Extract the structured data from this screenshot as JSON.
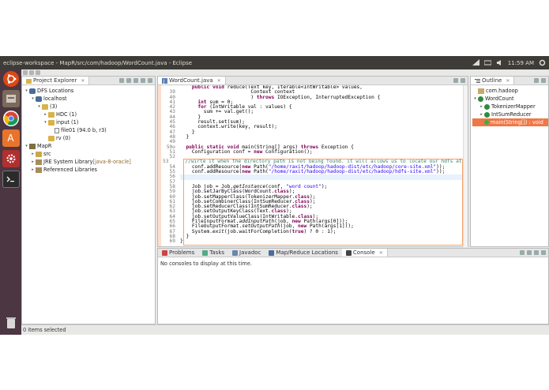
{
  "topbar": {
    "title": "eclipse-workspace - MapR/src/com/hadoop/WordCount.java - Eclipse",
    "time": "11:59 AM"
  },
  "launcher": {
    "icons": [
      "ubuntu-dash-icon",
      "files-icon",
      "chrome-icon",
      "amplifier-icon",
      "system-settings-icon",
      "eclipse-icon",
      "terminal-icon",
      "trash-icon"
    ]
  },
  "project_explorer": {
    "tab_label": "Project Explorer",
    "tree": [
      {
        "label": "DFS Locations",
        "indent": 0,
        "twisty": "▾",
        "icon": "elephant"
      },
      {
        "label": "localhost",
        "indent": 1,
        "twisty": "▾",
        "icon": "elephant"
      },
      {
        "label": "(3)",
        "indent": 2,
        "twisty": "▾",
        "icon": "folder"
      },
      {
        "label": "HDC (1)",
        "indent": 3,
        "twisty": "▸",
        "icon": "folder"
      },
      {
        "label": "input (1)",
        "indent": 3,
        "twisty": "▾",
        "icon": "folder"
      },
      {
        "label": "file01 (94.0 b, r3)",
        "indent": 4,
        "twisty": "",
        "icon": "file"
      },
      {
        "label": "rv (0)",
        "indent": 3,
        "twisty": "",
        "icon": "folder"
      },
      {
        "label": "MapR",
        "indent": 0,
        "twisty": "▾",
        "icon": "project"
      },
      {
        "label": "src",
        "indent": 1,
        "twisty": "▸",
        "icon": "src"
      },
      {
        "label": "JRE System Library",
        "tag": "[java-8-oracle]",
        "indent": 1,
        "twisty": "▸",
        "icon": "lib"
      },
      {
        "label": "Referenced Libraries",
        "indent": 1,
        "twisty": "▸",
        "icon": "lib"
      }
    ]
  },
  "editor": {
    "tab_label": "WordCount.java",
    "lines": [
      {
        "n": "",
        "t": "    public void reduce(Text key, Iterable<IntWritable> values,"
      },
      {
        "n": "39",
        "t": "                        Context context"
      },
      {
        "n": "40",
        "t": "                        ) throws IOException, InterruptedException {"
      },
      {
        "n": "41",
        "t": "      int sum = 0;"
      },
      {
        "n": "42",
        "t": "      for (IntWritable val : values) {"
      },
      {
        "n": "43",
        "t": "        sum += val.get();"
      },
      {
        "n": "44",
        "t": "      }"
      },
      {
        "n": "45",
        "t": "      result.set(sum);"
      },
      {
        "n": "46",
        "t": "      context.write(key, result);"
      },
      {
        "n": "47",
        "t": "    }"
      },
      {
        "n": "48",
        "t": "  }"
      },
      {
        "n": "49",
        "t": ""
      },
      {
        "n": "50⊖",
        "t": "  public static void main(String[] args) throws Exception {"
      },
      {
        "n": "51",
        "t": "    Configuration conf = new Configuration();"
      },
      {
        "n": "52",
        "t": ""
      },
      {
        "n": "53",
        "t": "    //wirte it when the directory path is not being found. it will allows us to locate our hdfs at /"
      },
      {
        "n": "54",
        "t": "    conf.addResource(new Path(\"/home/raxit/hadoop/hadoop-dist/etc/hadoop/core-site.xml\"));"
      },
      {
        "n": "55",
        "t": "    conf.addResource(new Path(\"/home/raxit/hadoop/hadoop-dist/etc/hadoop/hdfs-site.xml\"));"
      },
      {
        "n": "56",
        "t": ""
      },
      {
        "n": "57",
        "t": ""
      },
      {
        "n": "58",
        "t": "    Job job = Job.getInstance(conf, \"word count\");"
      },
      {
        "n": "59",
        "t": "    job.setJarByClass(WordCount.class);"
      },
      {
        "n": "60",
        "t": "    job.setMapperClass(TokenizerMapper.class);"
      },
      {
        "n": "61",
        "t": "    job.setCombinerClass(IntSumReducer.class);"
      },
      {
        "n": "62",
        "t": "    job.setReducerClass(IntSumReducer.class);"
      },
      {
        "n": "63",
        "t": "    job.setOutputKeyClass(Text.class);"
      },
      {
        "n": "64",
        "t": "    job.setOutputValueClass(IntWritable.class);"
      },
      {
        "n": "65",
        "t": "    FileInputFormat.addInputPath(job, new Path(args[0]));"
      },
      {
        "n": "66",
        "t": "    FileOutputFormat.setOutputPath(job, new Path(args[1]));"
      },
      {
        "n": "67",
        "t": "    System.exit(job.waitForCompletion(true) ? 0 : 1);"
      },
      {
        "n": "68",
        "t": "  }"
      },
      {
        "n": "69",
        "t": "}"
      }
    ],
    "current_line": "56"
  },
  "outline": {
    "tab_label": "Outline",
    "tree": [
      {
        "label": "com.hadoop",
        "indent": 0,
        "twisty": "",
        "icon": "pkg"
      },
      {
        "label": "WordCount",
        "indent": 0,
        "twisty": "▾",
        "icon": "class"
      },
      {
        "label": "TokenizerMapper",
        "indent": 1,
        "twisty": "▸",
        "icon": "class"
      },
      {
        "label": "IntSumReducer",
        "indent": 1,
        "twisty": "▸",
        "icon": "class"
      },
      {
        "label": "main(String[]) : void",
        "indent": 1,
        "twisty": "",
        "icon": "method",
        "selected": true
      }
    ]
  },
  "bottom": {
    "tabs": [
      "Problems",
      "Tasks",
      "Javadoc",
      "Map/Reduce Locations",
      "Console"
    ],
    "active": "Console",
    "message": "No consoles to display at this time."
  },
  "status": {
    "text": "0 items selected"
  },
  "colors": {
    "topbar": "#3d3c38",
    "launcher": "#4c3642",
    "selection": "#f07746",
    "keyword": "#7f0055",
    "comment": "#3f7f5f",
    "string": "#2a00ff"
  }
}
